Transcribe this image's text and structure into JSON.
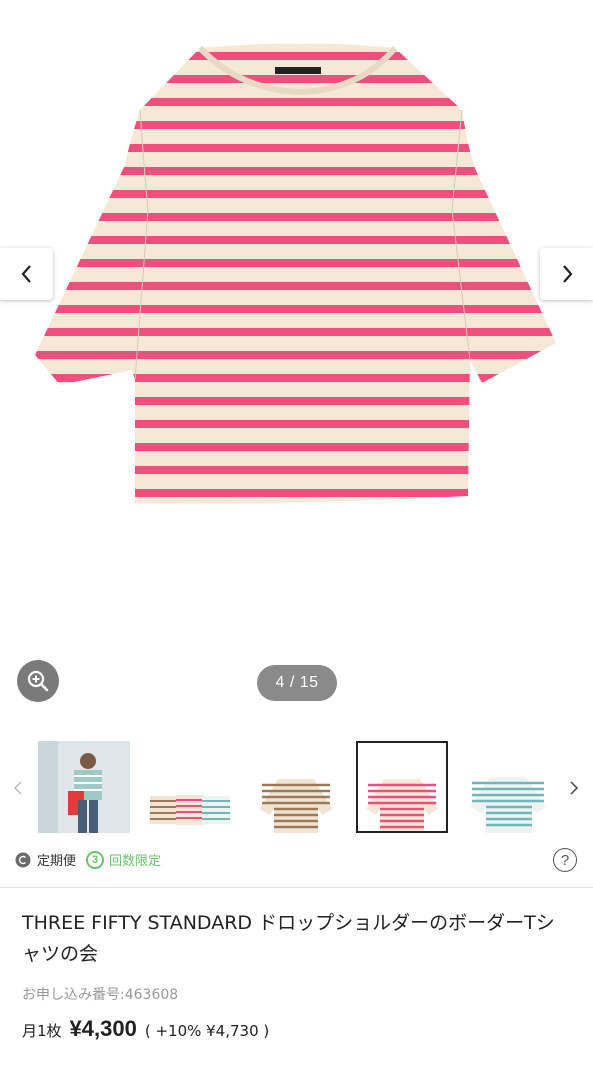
{
  "gallery": {
    "counter": "4 / 15",
    "current_index": 4,
    "total": 15,
    "prev_icon": "chevron-left-icon",
    "next_icon": "chevron-right-icon",
    "zoom_icon": "zoom-in-icon",
    "stripe_colors": {
      "main": "#ef4f7c",
      "base": "#f5e8d6",
      "thumb_brown": "#9c7a58",
      "thumb_teal": "#6fb8b8"
    }
  },
  "thumbnails": {
    "prev_icon": "chevron-left-icon",
    "next_icon": "chevron-right-icon",
    "selected_index": 3
  },
  "badges": {
    "regular_delivery": "定期便",
    "limited_times": "回数限定",
    "limited_number": "3",
    "help": "?"
  },
  "product": {
    "title": "THREE FIFTY STANDARD ドロップショルダーのボーダーTシャツの会",
    "order_number": "お申し込み番号:463608",
    "per_month": "月1枚",
    "price": "¥4,300",
    "tax": "( +10% ¥4,730 )"
  }
}
